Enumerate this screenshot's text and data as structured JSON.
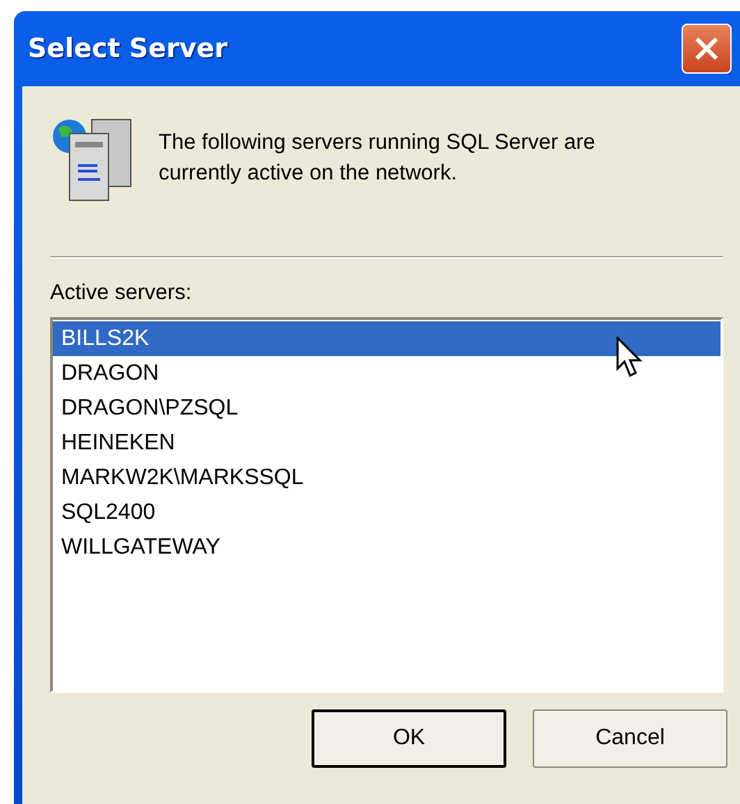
{
  "window": {
    "title": "Select Server"
  },
  "message": "The following servers running SQL Server are currently active on the network.",
  "list": {
    "label": "Active servers:",
    "items": [
      {
        "name": "BILLS2K",
        "selected": true
      },
      {
        "name": "DRAGON",
        "selected": false
      },
      {
        "name": "DRAGON\\PZSQL",
        "selected": false
      },
      {
        "name": "HEINEKEN",
        "selected": false
      },
      {
        "name": "MARKW2K\\MARKSSQL",
        "selected": false
      },
      {
        "name": "SQL2400",
        "selected": false
      },
      {
        "name": "WILLGATEWAY",
        "selected": false
      }
    ]
  },
  "buttons": [
    {
      "label": "OK",
      "default": true
    },
    {
      "label": "Cancel",
      "default": false
    }
  ]
}
